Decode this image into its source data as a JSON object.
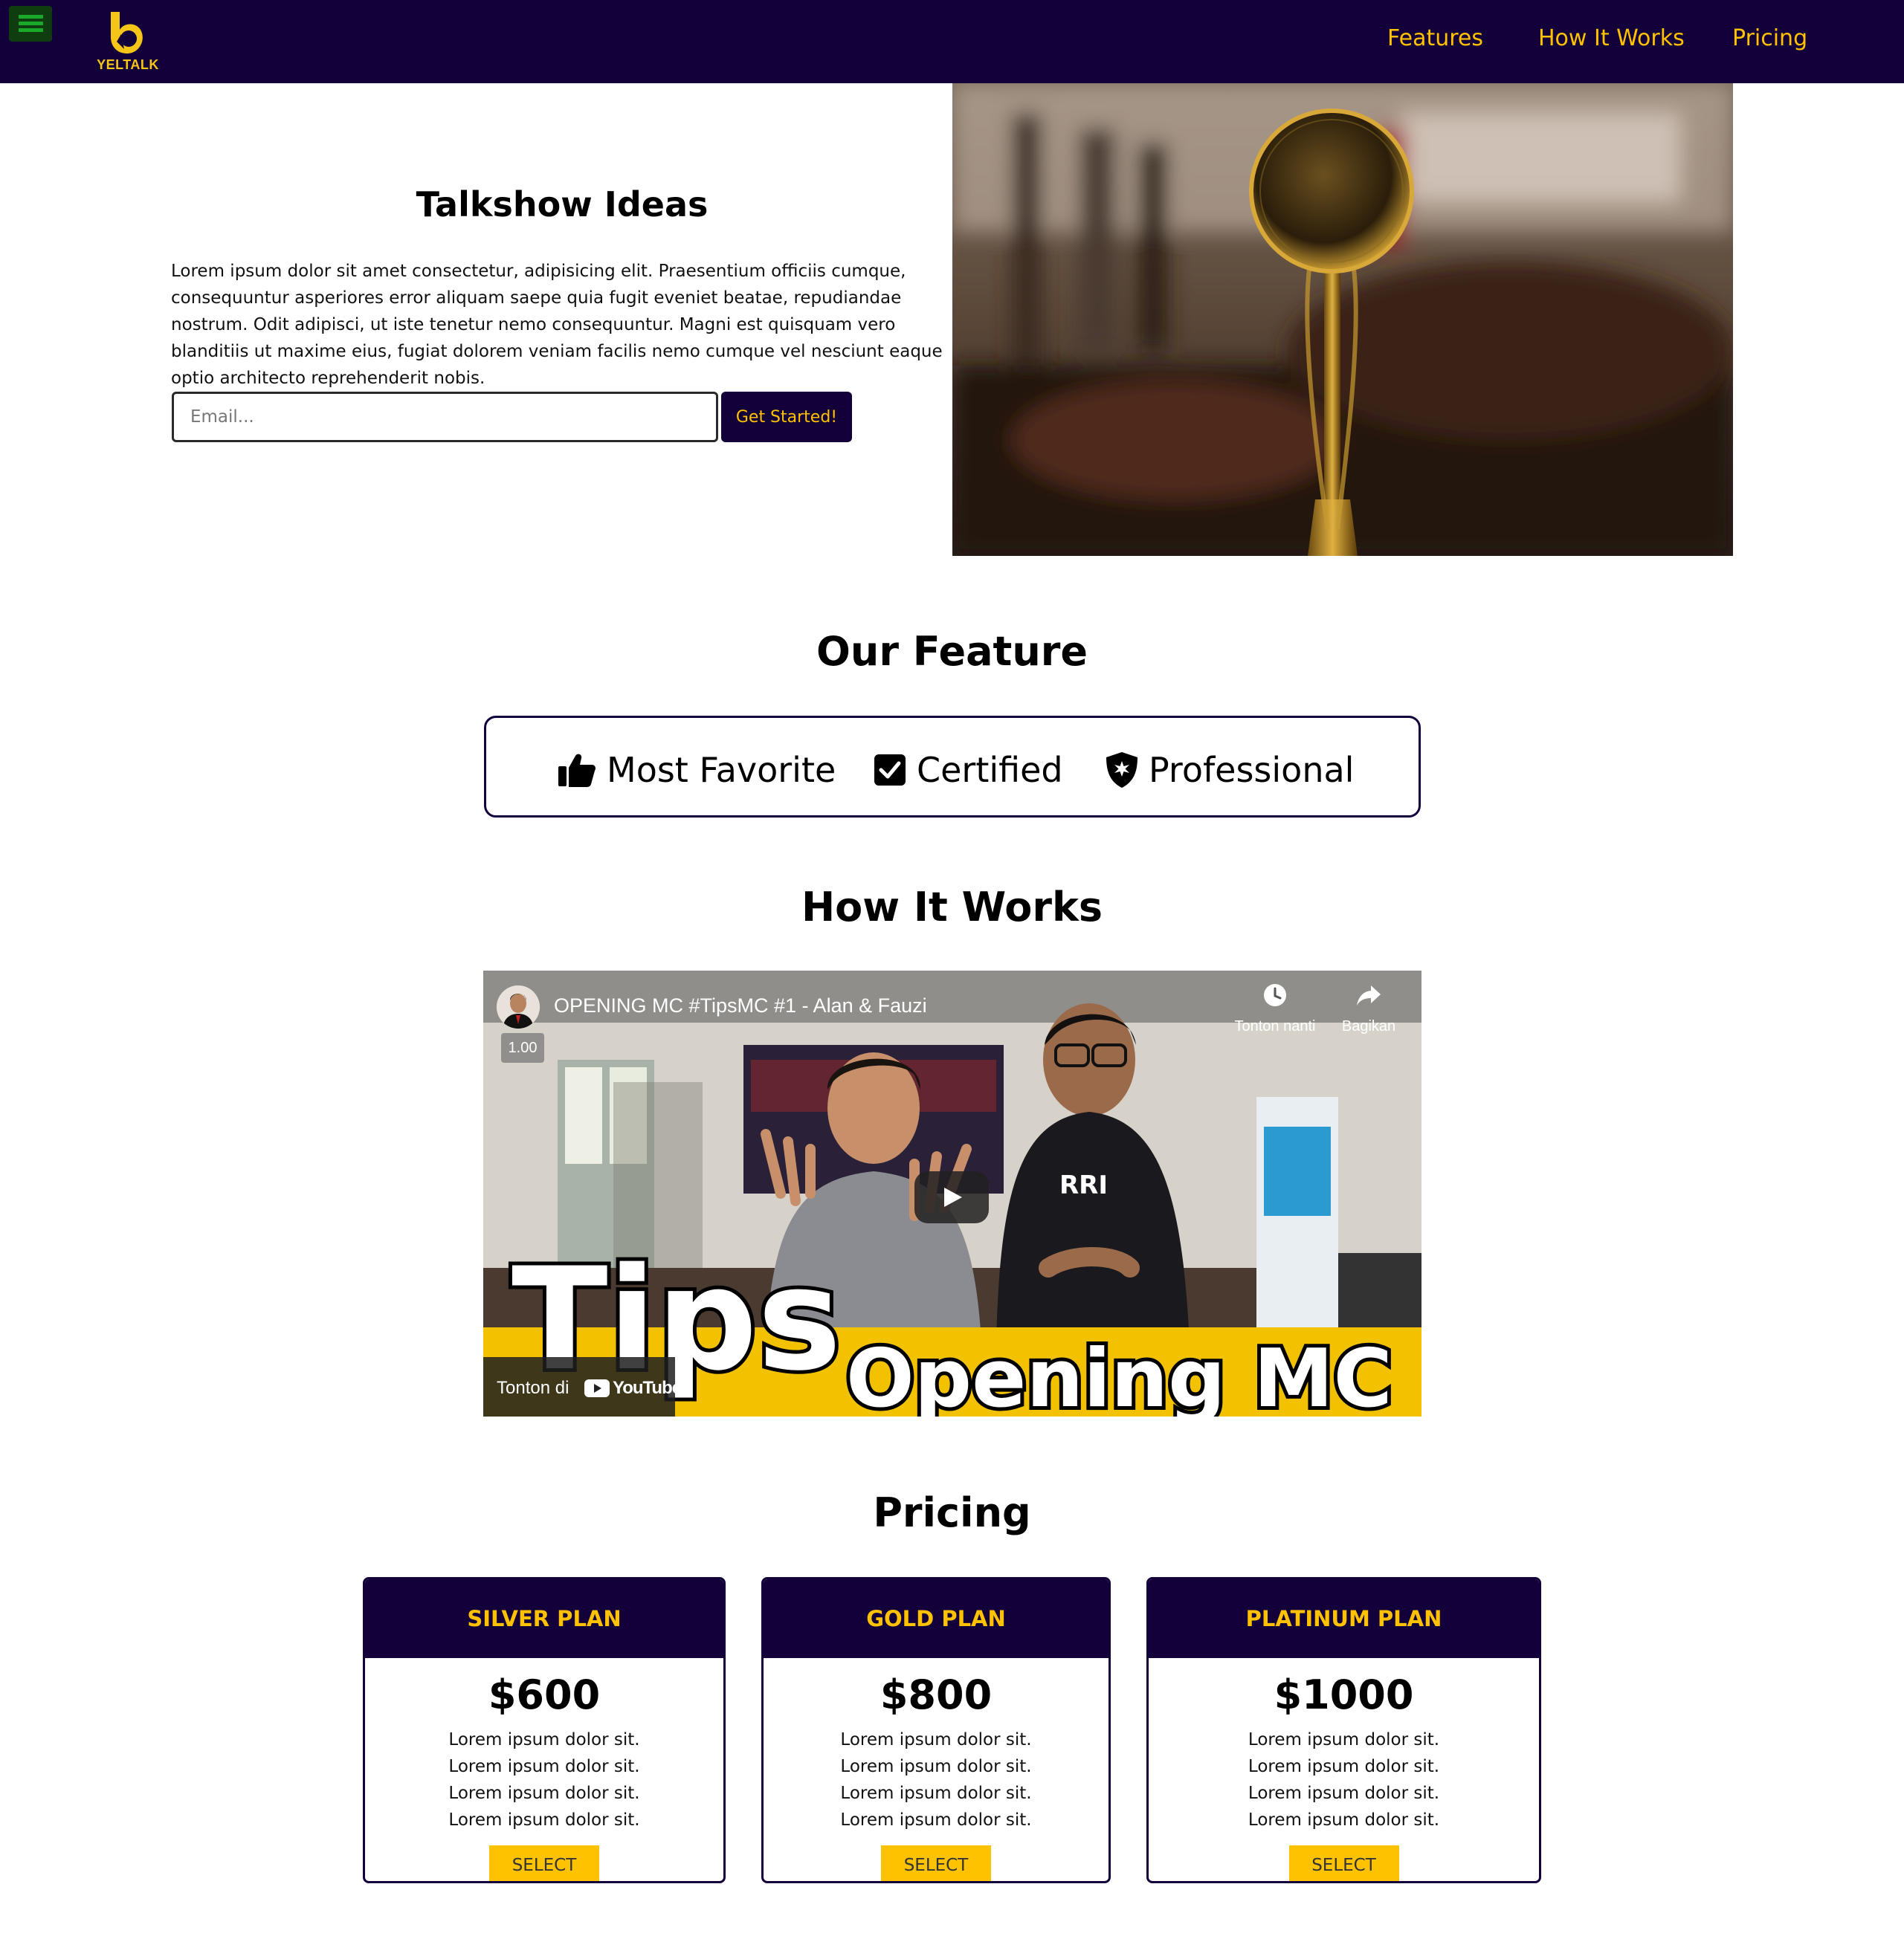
{
  "brand": {
    "name": "YELTALK",
    "accent": "#ffc200",
    "nav_bg": "#13003a"
  },
  "nav": {
    "links": [
      "Features",
      "How It Works",
      "Pricing"
    ]
  },
  "hero": {
    "title": "Talkshow Ideas",
    "text": "Lorem ipsum dolor sit amet consectetur, adipisicing elit. Praesentium officiis cumque, consequuntur asperiores error aliquam saepe quia fugit eveniet beatae, repudiandae nostrum. Odit adipisci, ut iste tenetur nemo consequuntur. Magni est quisquam vero blanditiis ut maxime eius, fugiat dolorem veniam facilis nemo cumque vel nesciunt eaque optio architecto reprehenderit nobis.",
    "email_placeholder": "Email...",
    "cta_label": "Get Started!"
  },
  "features": {
    "title": "Our Feature",
    "items": [
      {
        "label": "Most Favorite",
        "icon": "thumbs-up-icon"
      },
      {
        "label": "Certified",
        "icon": "check-square-icon"
      },
      {
        "label": "Professional",
        "icon": "shield-icon"
      }
    ]
  },
  "how_it_works": {
    "title": "How It Works",
    "video": {
      "title": "OPENING MC #TipsMC #1 - Alan & Fauzi",
      "speed": "1.00",
      "watch_later": "Tonton nanti",
      "share": "Bagikan",
      "watch_on": "Tonton di",
      "platform": "YouTube",
      "overlay_big": "Tips",
      "overlay_small": "Opening MC"
    }
  },
  "pricing": {
    "title": "Pricing",
    "plans": [
      {
        "name": "SILVER PLAN",
        "price": "$600",
        "features": [
          "Lorem ipsum dolor sit.",
          "Lorem ipsum dolor sit.",
          "Lorem ipsum dolor sit.",
          "Lorem ipsum dolor sit."
        ],
        "button": "SELECT"
      },
      {
        "name": "GOLD PLAN",
        "price": "$800",
        "features": [
          "Lorem ipsum dolor sit.",
          "Lorem ipsum dolor sit.",
          "Lorem ipsum dolor sit.",
          "Lorem ipsum dolor sit."
        ],
        "button": "SELECT"
      },
      {
        "name": "PLATINUM PLAN",
        "price": "$1000",
        "features": [
          "Lorem ipsum dolor sit.",
          "Lorem ipsum dolor sit.",
          "Lorem ipsum dolor sit.",
          "Lorem ipsum dolor sit."
        ],
        "button": "SELECT"
      }
    ]
  }
}
